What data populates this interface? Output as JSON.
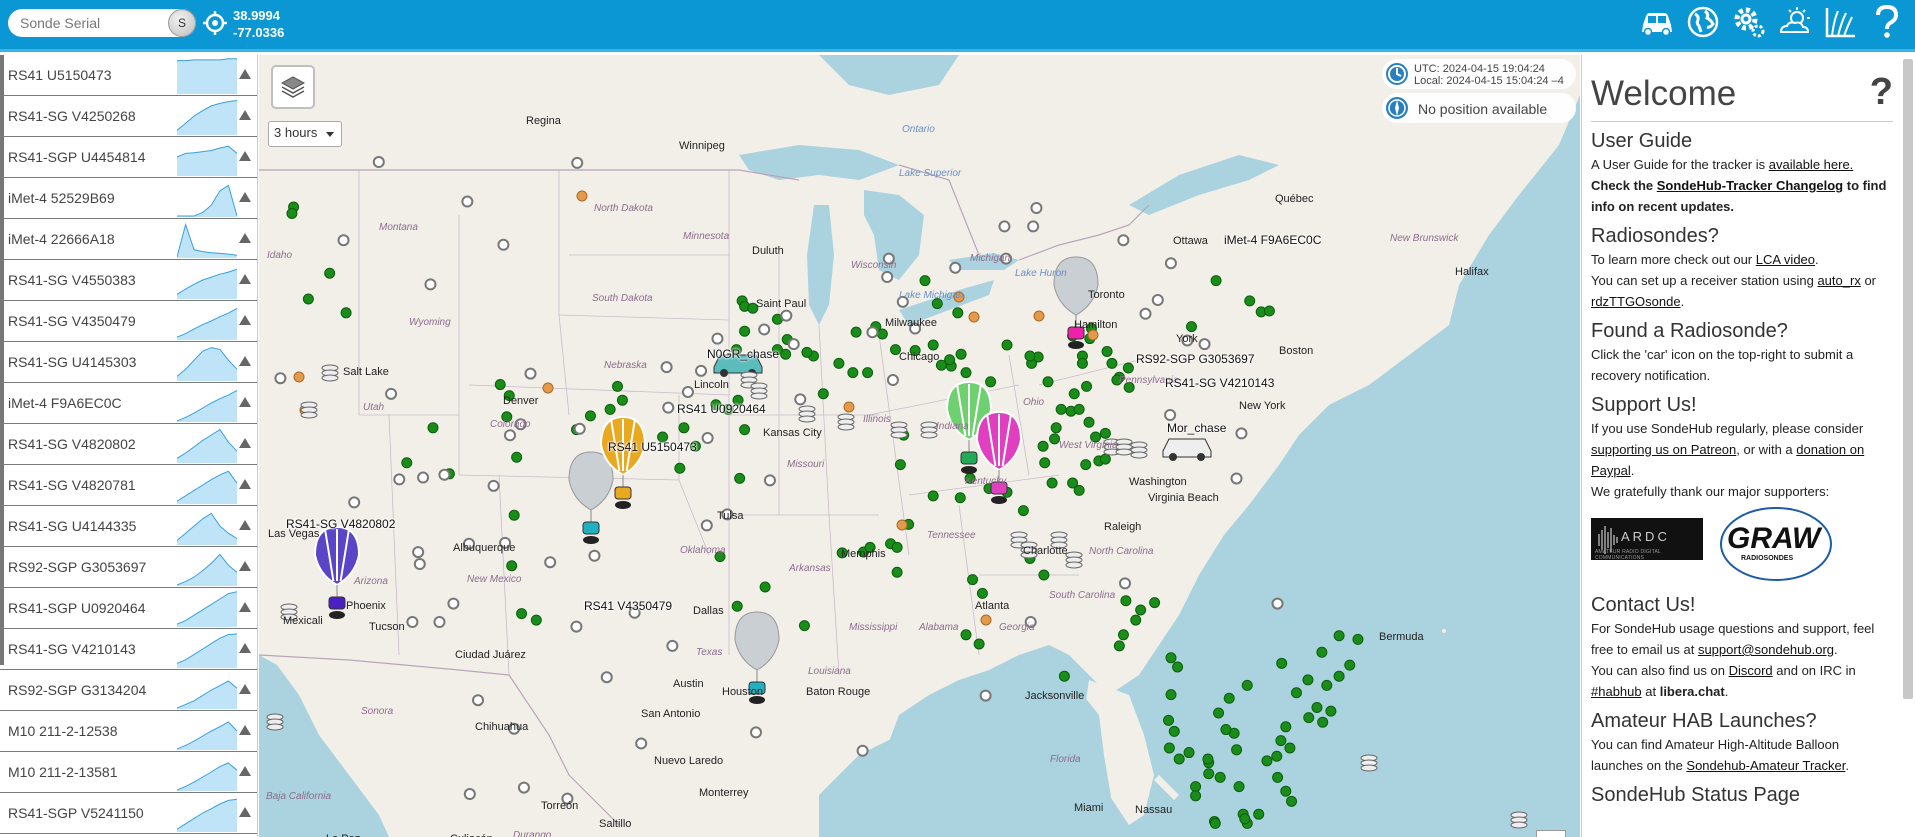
{
  "topbar": {
    "search_placeholder": "Sonde Serial",
    "search_button": "S",
    "latitude": "38.9994",
    "longitude": "-77.0336",
    "icons": [
      "car-icon",
      "globe-icon",
      "gears-icon",
      "weather-icon",
      "chart-icon",
      "help-icon"
    ]
  },
  "sidebar": {
    "sondes": [
      {
        "name": "RS41 U5150473",
        "spark": [
          0.9,
          0.9,
          0.92,
          0.92,
          0.92,
          0.92,
          0.95,
          0.95
        ]
      },
      {
        "name": "RS41-SG V4250268",
        "spark": [
          0.1,
          0.3,
          0.5,
          0.65,
          0.78,
          0.85,
          0.9,
          0.93
        ]
      },
      {
        "name": "RS41-SGP U4454814",
        "spark": [
          0.5,
          0.6,
          0.62,
          0.65,
          0.68,
          0.75,
          0.8,
          0.6
        ]
      },
      {
        "name": "iMet-4 52529B69",
        "spark": [
          0.0,
          0.0,
          0.0,
          0.1,
          0.3,
          0.7,
          0.85,
          0.0
        ]
      },
      {
        "name": "iMet-4 22666A18",
        "spark": [
          0.0,
          0.9,
          0.2,
          0.15,
          0.12,
          0.1,
          0.08,
          0.05
        ]
      },
      {
        "name": "RS41-SG V4550383",
        "spark": [
          0.1,
          0.25,
          0.38,
          0.5,
          0.58,
          0.66,
          0.72,
          0.8
        ]
      },
      {
        "name": "RS41-SG V4350479",
        "spark": [
          0.05,
          0.15,
          0.28,
          0.4,
          0.5,
          0.62,
          0.72,
          0.85
        ]
      },
      {
        "name": "RS41-SG U4145303",
        "spark": [
          0.1,
          0.3,
          0.55,
          0.8,
          0.9,
          0.85,
          0.55,
          0.3
        ]
      },
      {
        "name": "iMet-4 F9A6EC0C",
        "spark": [
          0.0,
          0.1,
          0.22,
          0.36,
          0.5,
          0.62,
          0.72,
          0.85
        ]
      },
      {
        "name": "RS41-SG V4820802",
        "spark": [
          0.1,
          0.25,
          0.42,
          0.6,
          0.75,
          0.9,
          0.55,
          0.3
        ]
      },
      {
        "name": "RS41-SG V4820781",
        "spark": [
          0.05,
          0.2,
          0.35,
          0.5,
          0.65,
          0.78,
          0.88,
          0.55
        ]
      },
      {
        "name": "RS41-SG U4144335",
        "spark": [
          0.1,
          0.3,
          0.5,
          0.7,
          0.85,
          0.5,
          0.3,
          0.15
        ]
      },
      {
        "name": "RS92-SGP G3053697",
        "spark": [
          0.0,
          0.1,
          0.22,
          0.4,
          0.6,
          0.85,
          0.55,
          0.35
        ]
      },
      {
        "name": "RS41-SGP U0920464",
        "spark": [
          0.05,
          0.15,
          0.3,
          0.45,
          0.6,
          0.75,
          0.9,
          0.95
        ]
      },
      {
        "name": "RS41-SG V4210143",
        "spark": [
          0.1,
          0.2,
          0.35,
          0.5,
          0.65,
          0.8,
          0.9,
          0.92
        ]
      },
      {
        "name": "RS92-SGP G3134204",
        "spark": [
          0.0,
          0.1,
          0.2,
          0.35,
          0.5,
          0.62,
          0.75,
          0.55
        ]
      },
      {
        "name": "M10 211-2-12538",
        "spark": [
          0.0,
          0.1,
          0.22,
          0.36,
          0.5,
          0.62,
          0.75,
          0.5
        ]
      },
      {
        "name": "M10 211-2-13581",
        "spark": [
          0.0,
          0.1,
          0.22,
          0.36,
          0.5,
          0.65,
          0.75,
          0.55
        ]
      },
      {
        "name": "RS41-SGP V5241150",
        "spark": [
          0.05,
          0.2,
          0.35,
          0.5,
          0.62,
          0.75,
          0.85,
          0.88
        ]
      }
    ]
  },
  "map": {
    "hours_select": "3 hours",
    "utc_time": "UTC: 2024-04-15 19:04:24",
    "local_time": "Local: 2024-04-15 15:04:24 –4",
    "position": "No position available",
    "sonde_labels": [
      "iMet-4 F9A6EC0C",
      "RS92-SGP G3053697",
      "RS41-SG V4210143",
      "Mor_chase",
      "N0GR_chase",
      "RS41 U0920464",
      "RS41 U5150473",
      "RS41-SG V4820802",
      "RS41 V4350479"
    ],
    "city_labels": [
      "Regina",
      "Winnipeg",
      "Montana",
      "North Dakota",
      "Minnesota",
      "Idaho",
      "South Dakota",
      "Wyoming",
      "Nebraska",
      "Salt Lake",
      "Utah",
      "Denver",
      "Colorado",
      "Lincoln",
      "Kansas City",
      "Missouri",
      "Las Vegas",
      "Albuquerque",
      "New Mexico",
      "Arizona",
      "Phoenix",
      "Tucson",
      "Mexicali",
      "Ciudad Juárez",
      "Oklahoma",
      "Tulsa",
      "Dallas",
      "Texas",
      "Austin",
      "San Antonio",
      "Houston",
      "Baton Rouge",
      "Louisiana",
      "Mississippi",
      "Alabama",
      "Georgia",
      "Atlanta",
      "Memphis",
      "Tennessee",
      "Arkansas",
      "Kentucky",
      "Indiana",
      "Illinois",
      "Chicago",
      "Milwaukee",
      "Wisconsin",
      "Michigan",
      "Lake Michigan",
      "Lake Superior",
      "Lake Huron",
      "Toronto",
      "Hamilton",
      "Ohio",
      "Pennsylvania",
      "West Virginia",
      "Washington",
      "Virginia Beach",
      "Raleigh",
      "North Carolina",
      "Charlotte",
      "South Carolina",
      "Jacksonville",
      "Florida",
      "Miami",
      "Nassau",
      "Bermuda",
      "Boston",
      "New York",
      "York",
      "Ottawa",
      "Québec",
      "Ontario",
      "Halifax",
      "New Brunswick",
      "Chihuahua",
      "Sonora",
      "Monterrey",
      "Nuevo Laredo",
      "Torreón",
      "Durango",
      "Saltillo",
      "Baja California",
      "Culiacán",
      "La Paz",
      "Saint Paul",
      "Duluth"
    ]
  },
  "panel": {
    "title": "Welcome",
    "help": "?",
    "user_guide": {
      "heading": "User Guide",
      "t1": "A User Guide for the tracker is ",
      "link1": "available here.",
      "t2": "Check the ",
      "link2": "SondeHub-Tracker Changelog",
      "t3": " to find info on recent updates."
    },
    "radiosondes": {
      "heading": "Radiosondes?",
      "t1": "To learn more check out our ",
      "link1": "LCA video",
      "t2": ".",
      "t3": "You can set up a receiver station using ",
      "link2": "auto_rx",
      "t4": " or ",
      "link3": "rdzTTGOsonde",
      "t5": "."
    },
    "found": {
      "heading": "Found a Radiosonde?",
      "text": "Click the 'car' icon on the top-right to submit a recovery notification."
    },
    "support": {
      "heading": "Support Us!",
      "t1": "If you use SondeHub regularly, please consider ",
      "link1": "supporting us on Patreon",
      "t2": ", or with a ",
      "link2": "donation on Paypal",
      "t3": ".",
      "t4": "We gratefully thank our major supporters:"
    },
    "sponsors": {
      "ardc": "ARDC",
      "ardc_sub": "AMATEUR RADIO DIGITAL COMMUNICATIONS",
      "graw": "GRAW",
      "graw_sub": "RADIOSONDES"
    },
    "contact": {
      "heading": "Contact Us!",
      "t1": "For SondeHub usage questions and support, feel free to email us at ",
      "link1": "support@sondehub.org",
      "t2": ".",
      "t3": "You can also find us on ",
      "link2": "Discord",
      "t4": " and on IRC in ",
      "link3": "#habhub",
      "t5": " at ",
      "t6": "libera.chat",
      "t7": "."
    },
    "hab": {
      "heading": "Amateur HAB Launches?",
      "t1": "You can find Amateur High-Altitude Balloon launches on the ",
      "link1": "Sondehub-Amateur Tracker",
      "t2": "."
    },
    "next_heading": "SondeHub Status Page"
  },
  "colors": {
    "topbar": "#0a97d3",
    "water": "#aad3df",
    "land": "#f2efe9",
    "station_green": "#1a8c1a",
    "spark_fill": "#bfe3f7",
    "spark_line": "#3aa0dc"
  }
}
